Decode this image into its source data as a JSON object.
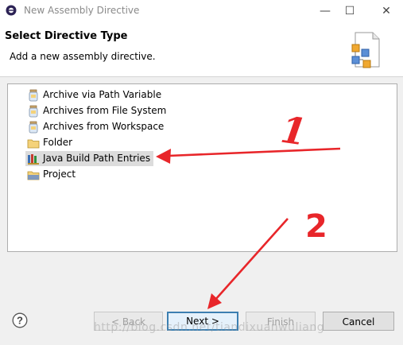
{
  "window": {
    "title": "New Assembly Directive",
    "minimize_symbol": "—",
    "maximize_symbol": "☐",
    "close_symbol": "✕"
  },
  "banner": {
    "title": "Select Directive Type",
    "description": "Add a new assembly directive.",
    "icon": "assembly-wizard-icon"
  },
  "directive_types": [
    {
      "label": "Archive via Path Variable",
      "icon": "jar-icon"
    },
    {
      "label": "Archives from File System",
      "icon": "jar-icon"
    },
    {
      "label": "Archives from Workspace",
      "icon": "jar-icon"
    },
    {
      "label": "Folder",
      "icon": "folder-icon"
    },
    {
      "label": "Java Build Path Entries",
      "icon": "library-icon",
      "selected": true
    },
    {
      "label": "Project",
      "icon": "project-folder-icon"
    }
  ],
  "buttons": {
    "back": "< Back",
    "next": "Next >",
    "finish": "Finish",
    "cancel": "Cancel"
  },
  "help_symbol": "?",
  "annotations": {
    "step1": "1",
    "step2": "2",
    "color": "#e8262a"
  },
  "watermark": "http://blog.csdn.net/tiandixuanwuliang"
}
